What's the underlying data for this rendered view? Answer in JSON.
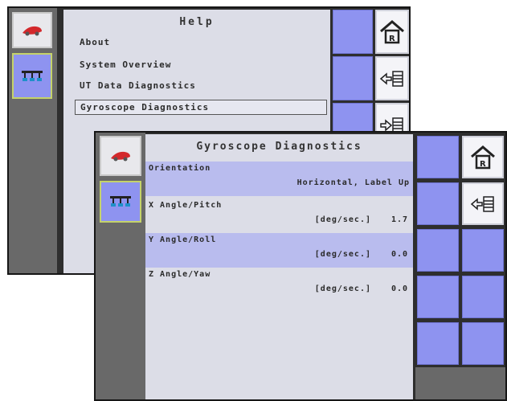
{
  "help_screen": {
    "title": "Help",
    "items": [
      {
        "label": "About",
        "selected": false
      },
      {
        "label": "System Overview",
        "selected": false
      },
      {
        "label": "UT Data Diagnostics",
        "selected": false
      },
      {
        "label": "Gyroscope Diagnostics",
        "selected": true
      }
    ]
  },
  "gyro_screen": {
    "title": "Gyroscope Diagnostics",
    "rows": [
      {
        "label": "Orientation",
        "value": "Horizontal, Label Up"
      },
      {
        "label": "X Angle/Pitch",
        "unit": "[deg/sec.]",
        "value": "1.7"
      },
      {
        "label": "Y Angle/Roll",
        "unit": "[deg/sec.]",
        "value": "0.0"
      },
      {
        "label": "Z Angle/Yaw",
        "unit": "[deg/sec.]",
        "value": "0.0"
      }
    ]
  },
  "icons": {
    "left_tab_1": "sprayer-machine-icon",
    "left_tab_2": "boom-spray-icon",
    "softkey_home": "home-icon",
    "softkey_back": "back-arrow-list-icon",
    "softkey_forward": "forward-arrow-list-icon"
  },
  "colors": {
    "softkey": "#8e93f0",
    "highlight_row": "#b9bcee",
    "content_bg": "#dcdde7",
    "left_bar": "#696969",
    "active_tab_border": "#c5d36a"
  }
}
